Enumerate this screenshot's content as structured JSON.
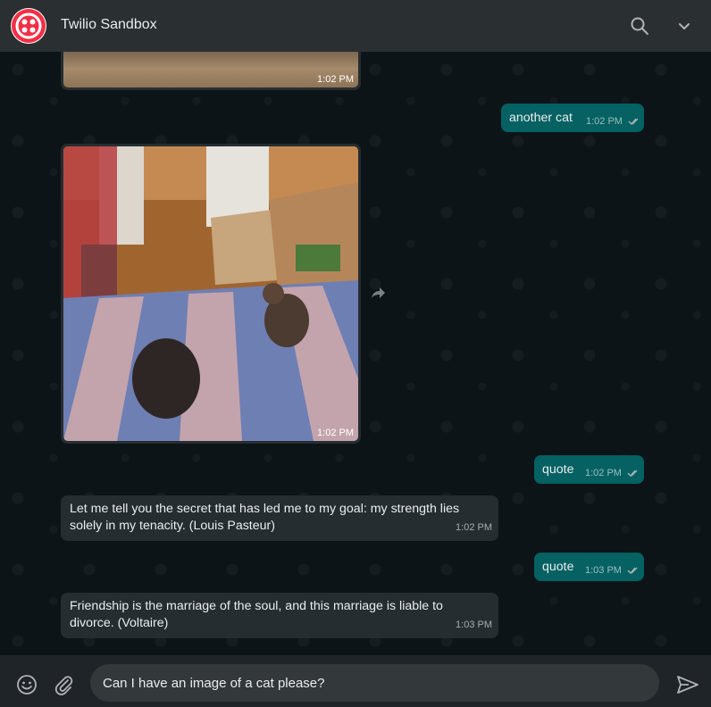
{
  "header": {
    "title": "Twilio Sandbox",
    "avatar_icon": "twilio-logo-icon",
    "search_icon": "search-icon",
    "menu_icon": "chevron-down-icon"
  },
  "colors": {
    "header_bg": "#2a2f32",
    "chat_bg": "#0d1418",
    "incoming_bubble": "#262d31",
    "outgoing_bubble": "#056162",
    "brand_red": "#f22f46"
  },
  "messages": [
    {
      "direction": "in",
      "type": "image",
      "time": "1:02 PM"
    },
    {
      "direction": "out",
      "type": "text",
      "text": "another cat",
      "time": "1:02 PM",
      "status_icon": "double-check-icon"
    },
    {
      "direction": "in",
      "type": "image",
      "time": "1:02 PM",
      "action_icon": "forward-icon"
    },
    {
      "direction": "out",
      "type": "text",
      "text": "quote",
      "time": "1:02 PM",
      "status_icon": "double-check-icon"
    },
    {
      "direction": "in",
      "type": "text",
      "text": "Let me tell you the secret that has led me to my goal: my strength lies solely in my tenacity. (Louis Pasteur)",
      "time": "1:02 PM"
    },
    {
      "direction": "out",
      "type": "text",
      "text": "quote",
      "time": "1:03 PM",
      "status_icon": "double-check-icon"
    },
    {
      "direction": "in",
      "type": "text",
      "text": "Friendship is the marriage of the soul, and this marriage is liable to divorce. (Voltaire)",
      "time": "1:03 PM"
    }
  ],
  "composer": {
    "value": "Can I have an image of a cat please?",
    "emoji_icon": "emoji-icon",
    "attach_icon": "paperclip-icon",
    "send_icon": "send-icon"
  }
}
